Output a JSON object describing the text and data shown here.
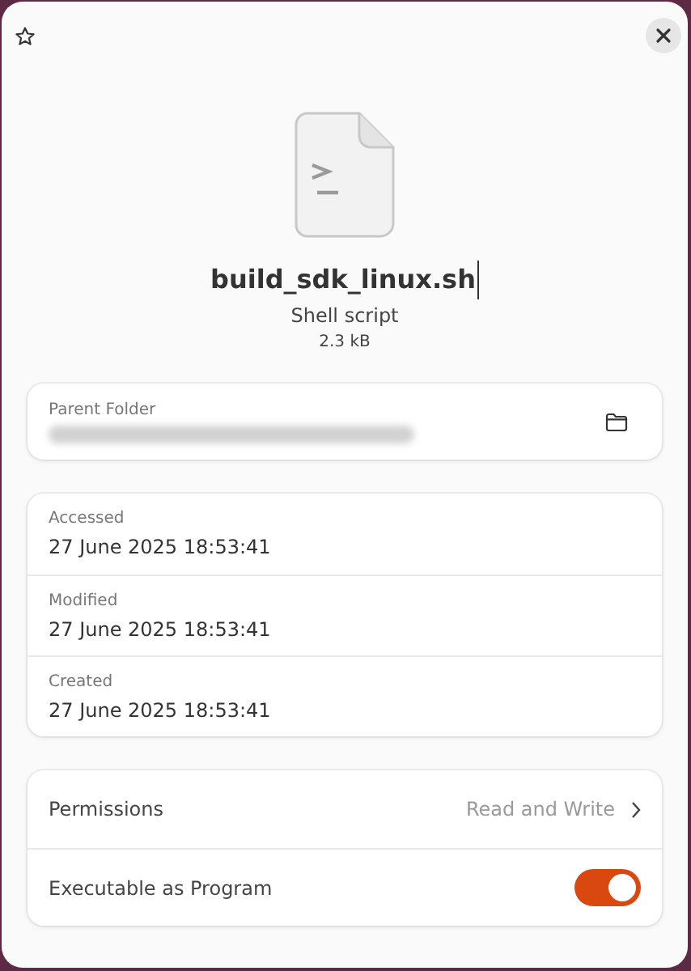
{
  "file": {
    "name": "build_sdk_linux.sh",
    "type": "Shell script",
    "size": "2.3 kB"
  },
  "parent_folder": {
    "label": "Parent Folder"
  },
  "times": [
    {
      "label": "Accessed",
      "value": "27 June 2025 18:53:41"
    },
    {
      "label": "Modified",
      "value": "27 June 2025 18:53:41"
    },
    {
      "label": "Created",
      "value": "27 June 2025 18:53:41"
    }
  ],
  "settings": [
    {
      "kind": "link",
      "label": "Permissions",
      "value": "Read and Write"
    },
    {
      "kind": "switch",
      "label": "Executable as Program",
      "on": true
    }
  ]
}
